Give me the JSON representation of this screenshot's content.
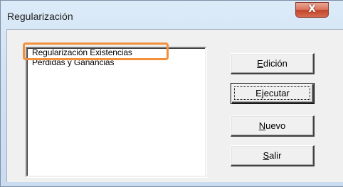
{
  "window": {
    "title": "Regularización",
    "close_label": "X"
  },
  "list": {
    "items": [
      "Regularización Existencias",
      "Pérdidas y Ganancias"
    ],
    "highlighted_index": 0,
    "highlight_color": "#f2903c"
  },
  "buttons": {
    "edicion": {
      "mnemonic": "E",
      "rest": "dición"
    },
    "ejecutar": {
      "mnemonic": "j",
      "prefix": "E",
      "rest": "ecutar"
    },
    "nuevo": {
      "mnemonic": "N",
      "rest": "uevo"
    },
    "salir": {
      "mnemonic": "S",
      "rest": "alir"
    }
  }
}
